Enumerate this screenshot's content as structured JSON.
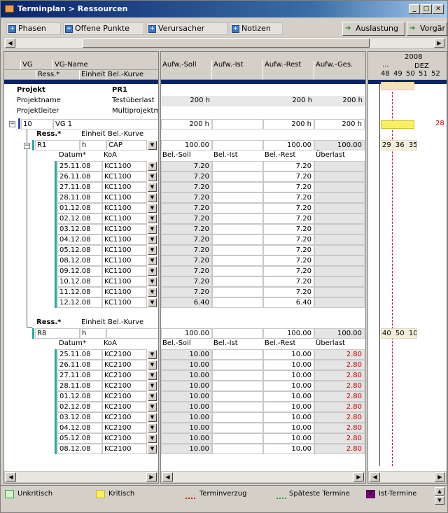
{
  "window": {
    "title": "Terminplan > Ressourcen"
  },
  "toolbar": {
    "tabs": [
      "Phasen",
      "Offene Punkte",
      "Verursacher",
      "Notizen"
    ],
    "right": [
      "Auslastung",
      "Vorgär"
    ]
  },
  "left_header": {
    "row1": [
      "VG",
      "VG-Name"
    ],
    "row2": [
      "Ress.*",
      "Einheit",
      "Bel.-Kurve"
    ]
  },
  "mid_header": [
    "Aufw.-Soll",
    "Aufw.-Ist",
    "Aufw.-Rest",
    "Aufw.-Ges."
  ],
  "gantt_header": {
    "year": "2008",
    "ellipsis": "...",
    "month": "DEZ",
    "weeks": [
      "48",
      "49",
      "50",
      "51",
      "52"
    ]
  },
  "project": {
    "label": "Projekt",
    "value": "PR1",
    "name_label": "Projektname",
    "name_value": "Testüberlast",
    "lead_label": "Projektleiter",
    "lead_value": "Multiprojektma",
    "soll": "200 h",
    "rest": "200 h",
    "ges": "200 h"
  },
  "vg": {
    "num": "10",
    "name": "VG 1",
    "soll": "200 h",
    "rest": "200 h",
    "ges": "200 h",
    "gantt_num": "28"
  },
  "sub_hdr": {
    "ress": "Ress.*",
    "einheit": "Einheit",
    "kurve": "Bel.-Kurve"
  },
  "detail_hdr": {
    "datum": "Datum*",
    "koa": "KoA",
    "soll": "Bel.-Soll",
    "ist": "Bel.-Ist",
    "rest": "Bel.-Rest",
    "ueber": "Überlast"
  },
  "r1": {
    "name": "R1",
    "unit": "h",
    "curve": "CAP",
    "soll": "100.00",
    "rest": "100.00",
    "ges": "100.00",
    "gantt": [
      "29",
      "36",
      "35"
    ],
    "rows": [
      {
        "d": "25.11.08",
        "k": "KC1100",
        "s": "7.20",
        "r": "7.20"
      },
      {
        "d": "26.11.08",
        "k": "KC1100",
        "s": "7.20",
        "r": "7.20"
      },
      {
        "d": "27.11.08",
        "k": "KC1100",
        "s": "7.20",
        "r": "7.20"
      },
      {
        "d": "28.11.08",
        "k": "KC1100",
        "s": "7.20",
        "r": "7.20"
      },
      {
        "d": "01.12.08",
        "k": "KC1100",
        "s": "7.20",
        "r": "7.20"
      },
      {
        "d": "02.12.08",
        "k": "KC1100",
        "s": "7.20",
        "r": "7.20"
      },
      {
        "d": "03.12.08",
        "k": "KC1100",
        "s": "7.20",
        "r": "7.20"
      },
      {
        "d": "04.12.08",
        "k": "KC1100",
        "s": "7.20",
        "r": "7.20"
      },
      {
        "d": "05.12.08",
        "k": "KC1100",
        "s": "7.20",
        "r": "7.20"
      },
      {
        "d": "08.12.08",
        "k": "KC1100",
        "s": "7.20",
        "r": "7.20"
      },
      {
        "d": "09.12.08",
        "k": "KC1100",
        "s": "7.20",
        "r": "7.20"
      },
      {
        "d": "10.12.08",
        "k": "KC1100",
        "s": "7.20",
        "r": "7.20"
      },
      {
        "d": "11.12.08",
        "k": "KC1100",
        "s": "7.20",
        "r": "7.20"
      },
      {
        "d": "12.12.08",
        "k": "KC1100",
        "s": "6.40",
        "r": "6.40"
      }
    ]
  },
  "r8": {
    "name": "R8",
    "unit": "h",
    "soll": "100.00",
    "rest": "100.00",
    "ges": "100.00",
    "gantt": [
      "40",
      "50",
      "10"
    ],
    "rows": [
      {
        "d": "25.11.08",
        "k": "KC2100",
        "s": "10.00",
        "r": "10.00",
        "u": "2.80"
      },
      {
        "d": "26.11.08",
        "k": "KC2100",
        "s": "10.00",
        "r": "10.00",
        "u": "2.80"
      },
      {
        "d": "27.11.08",
        "k": "KC2100",
        "s": "10.00",
        "r": "10.00",
        "u": "2.80"
      },
      {
        "d": "28.11.08",
        "k": "KC2100",
        "s": "10.00",
        "r": "10.00",
        "u": "2.80"
      },
      {
        "d": "01.12.08",
        "k": "KC2100",
        "s": "10.00",
        "r": "10.00",
        "u": "2.80"
      },
      {
        "d": "02.12.08",
        "k": "KC2100",
        "s": "10.00",
        "r": "10.00",
        "u": "2.80"
      },
      {
        "d": "03.12.08",
        "k": "KC2100",
        "s": "10.00",
        "r": "10.00",
        "u": "2.80"
      },
      {
        "d": "04.12.08",
        "k": "KC2100",
        "s": "10.00",
        "r": "10.00",
        "u": "2.80"
      },
      {
        "d": "05.12.08",
        "k": "KC2100",
        "s": "10.00",
        "r": "10.00",
        "u": "2.80"
      },
      {
        "d": "08.12.08",
        "k": "KC2100",
        "s": "10.00",
        "r": "10.00",
        "u": "2.80"
      }
    ]
  },
  "legend": {
    "items": [
      "Unkritisch",
      "Kritisch",
      "Terminverzug",
      "Späteste Termine",
      "Ist-Termine"
    ]
  },
  "colors": {
    "unkritisch": "#d8f0d0",
    "kritisch": "#f8f060",
    "ist": "#800080",
    "navy": "#0a246a",
    "teal": "#2aa8a0",
    "overload": "#d00000"
  }
}
